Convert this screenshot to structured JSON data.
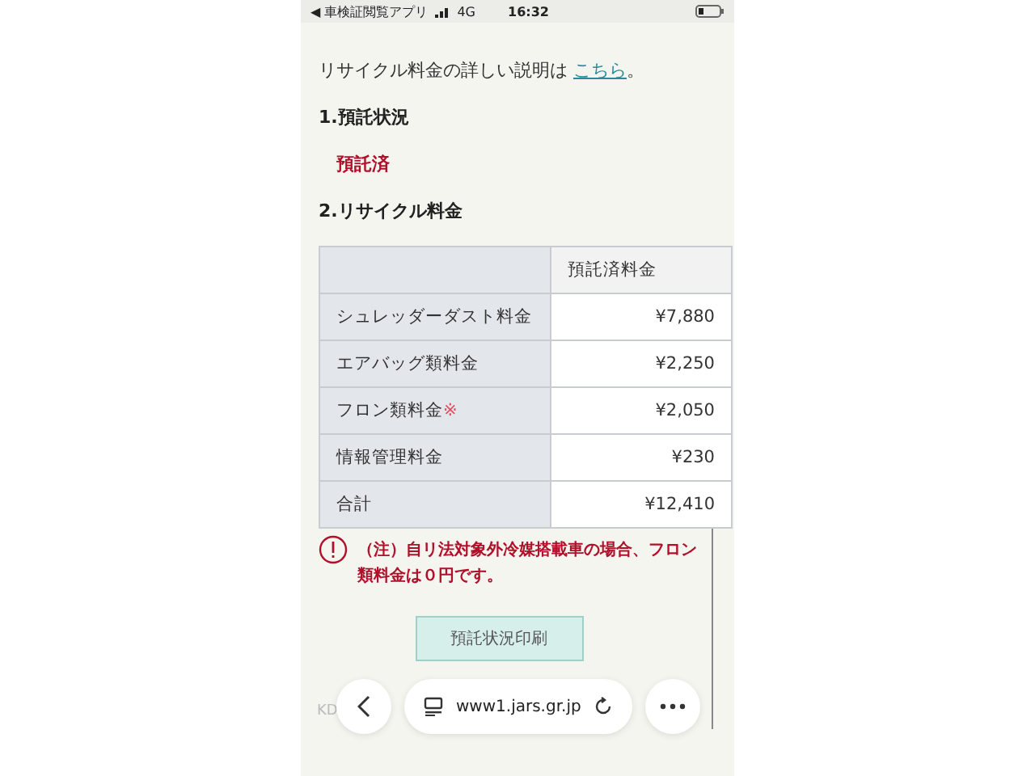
{
  "status_bar": {
    "back_app": "◀ 車検証閲覧アプリ",
    "network": "4G",
    "time": "16:32"
  },
  "intro": {
    "text": "リサイクル料金の詳しい説明は",
    "link": "こちら",
    "tail": "。"
  },
  "section1": {
    "heading": "1.預託状況",
    "status": "預託済"
  },
  "section2": {
    "heading": "2.リサイクル料金",
    "column_header": "預託済料金",
    "rows": [
      {
        "label": "シュレッダーダスト料金",
        "amount": "¥7,880"
      },
      {
        "label": "エアバッグ類料金",
        "amount": "¥2,250"
      },
      {
        "label": "フロン類料金",
        "mark": "※",
        "amount": "¥2,050"
      },
      {
        "label": "情報管理料金",
        "amount": "¥230"
      },
      {
        "label": "合計",
        "amount": "¥12,410"
      }
    ],
    "note": "（注）自リ法対象外冷媒搭載車の場合、フロン類料金は０円です。"
  },
  "print_button": "預託状況印刷",
  "footer_text": "KD",
  "browser_bar": {
    "url": "www1.jars.gr.jp"
  }
}
